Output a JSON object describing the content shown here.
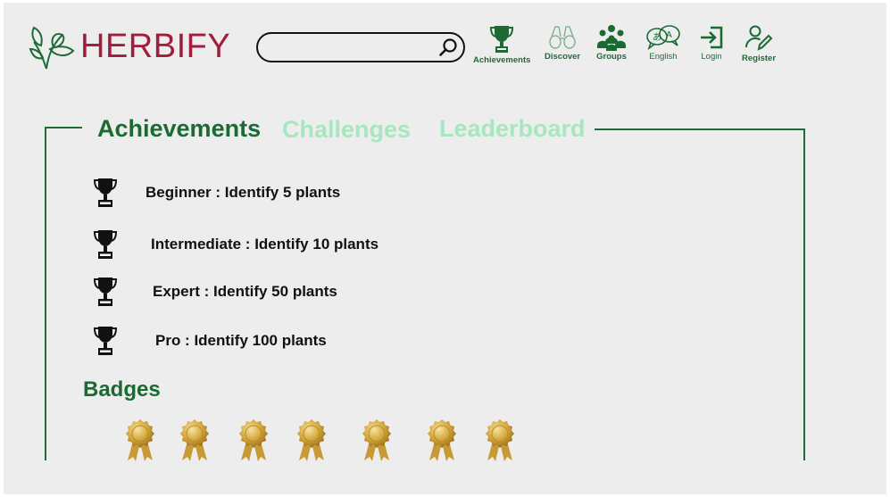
{
  "header": {
    "logo_text": "HERBIFY",
    "search": {
      "placeholder": "",
      "value": ""
    },
    "nav": [
      {
        "label": "Achievements",
        "icon": "trophy-icon"
      },
      {
        "label": "Discover",
        "icon": "binoculars-icon"
      },
      {
        "label": "Groups",
        "icon": "groups-icon"
      },
      {
        "label": "English",
        "icon": "language-icon"
      },
      {
        "label": "Login",
        "icon": "login-icon"
      },
      {
        "label": "Register",
        "icon": "register-icon"
      }
    ]
  },
  "tabs": [
    {
      "label": "Achievements",
      "active": true
    },
    {
      "label": "Challenges",
      "active": false
    },
    {
      "label": "Leaderboard",
      "active": false
    }
  ],
  "achievements": [
    {
      "text": "Beginner : Identify 5 plants",
      "icon": "trophy-icon"
    },
    {
      "text": "Intermediate : Identify 10 plants",
      "icon": "trophy-icon"
    },
    {
      "text": "Expert : Identify 50 plants",
      "icon": "trophy-icon"
    },
    {
      "text": "Pro : Identify 100 plants",
      "icon": "trophy-icon"
    }
  ],
  "badges": {
    "title": "Badges",
    "count": 7,
    "icon": "gold-medal-icon"
  },
  "colors": {
    "brand_green": "#1a6a32",
    "tab_inactive": "#a6e8be",
    "logo_red": "#a01d3c",
    "gold": "#d4a63a"
  }
}
